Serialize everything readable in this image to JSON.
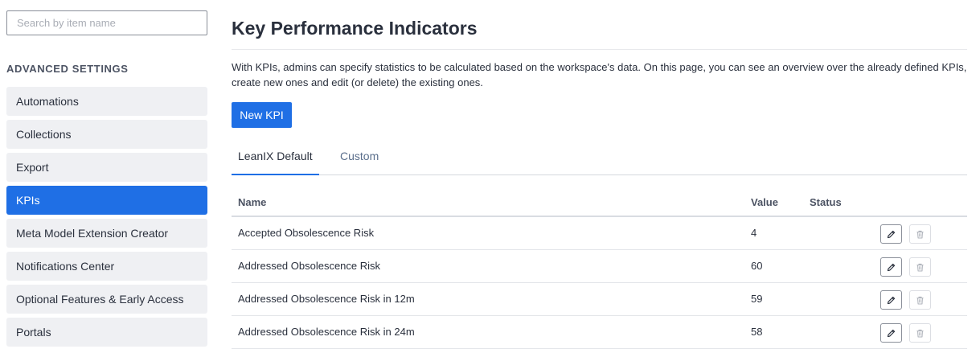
{
  "sidebar": {
    "search_placeholder": "Search by item name",
    "section_title": "ADVANCED SETTINGS",
    "items": [
      {
        "label": "Automations",
        "active": false
      },
      {
        "label": "Collections",
        "active": false
      },
      {
        "label": "Export",
        "active": false
      },
      {
        "label": "KPIs",
        "active": true
      },
      {
        "label": "Meta Model Extension Creator",
        "active": false
      },
      {
        "label": "Notifications Center",
        "active": false
      },
      {
        "label": "Optional Features & Early Access",
        "active": false
      },
      {
        "label": "Portals",
        "active": false
      }
    ]
  },
  "main": {
    "title": "Key Performance Indicators",
    "description": "With KPIs, admins can specify statistics to be calculated based on the workspace's data. On this page, you can see an overview over the already defined KPIs, create new ones and edit (or delete) the existing ones.",
    "new_button": "New KPI",
    "tabs": [
      {
        "label": "LeanIX Default",
        "active": true
      },
      {
        "label": "Custom",
        "active": false
      }
    ],
    "table": {
      "columns": [
        "Name",
        "Value",
        "Status"
      ],
      "rows": [
        {
          "name": "Accepted Obsolescence Risk",
          "value": "4",
          "status": ""
        },
        {
          "name": "Addressed Obsolescence Risk",
          "value": "60",
          "status": ""
        },
        {
          "name": "Addressed Obsolescence Risk in 12m",
          "value": "59",
          "status": ""
        },
        {
          "name": "Addressed Obsolescence Risk in 24m",
          "value": "58",
          "status": ""
        }
      ]
    },
    "icons": {
      "edit": "pencil-icon",
      "delete": "trash-icon"
    }
  },
  "colors": {
    "accent": "#1f6fe5",
    "nav_bg": "#eff0f3",
    "text": "#2a303d",
    "muted_tab": "#5b6f8c"
  }
}
